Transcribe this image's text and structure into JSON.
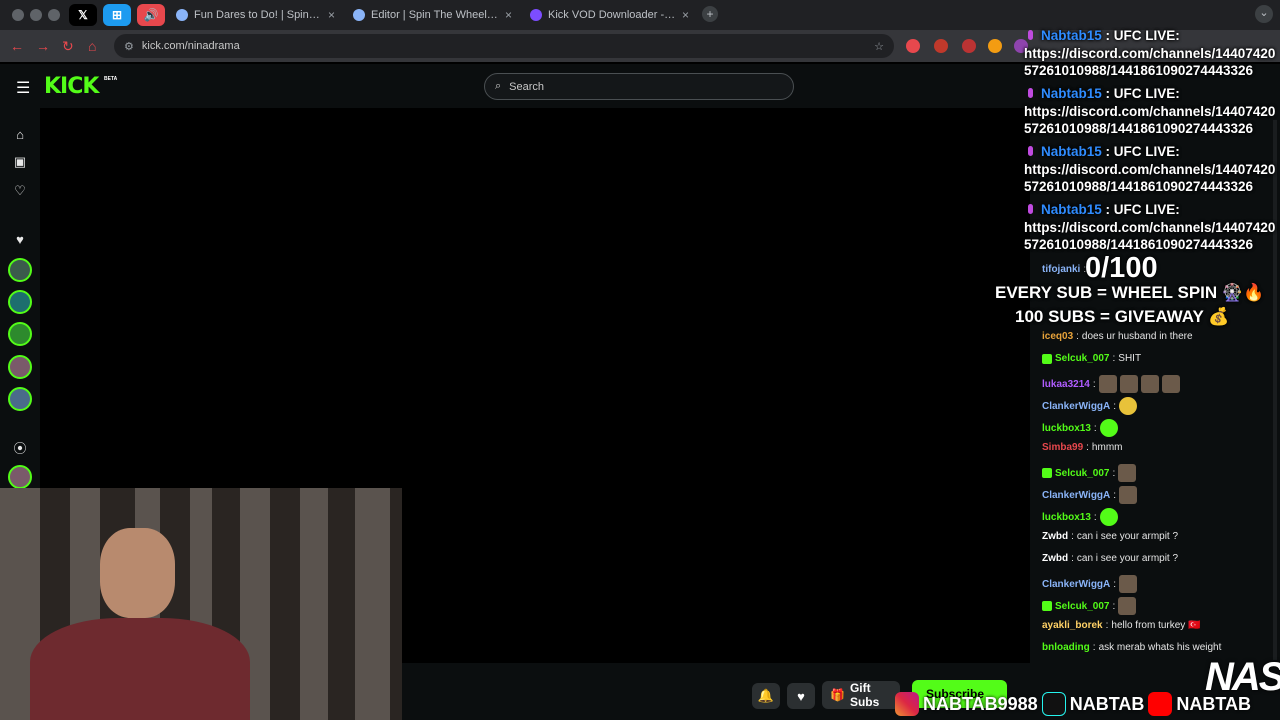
{
  "browser": {
    "pinned_tabs": [
      "𝕏",
      "⊞",
      "🔊"
    ],
    "tabs": [
      {
        "title": "Fun Dares to Do! | Spin The W",
        "close": "×"
      },
      {
        "title": "Editor | Spin The Wheel - Ran",
        "close": "×"
      },
      {
        "title": "Kick VOD Downloader - Strea",
        "close": "×"
      }
    ],
    "new_tab": "+",
    "url": "kick.com/ninadrama",
    "dropdown": "⌄"
  },
  "kick": {
    "logo": "KICK",
    "beta": "BETA",
    "search_placeholder": "Search",
    "gift_subs": "Gift Subs",
    "subscribe": "Subscribe"
  },
  "chat": [
    {
      "user": "tifojanki",
      "color": "#8ab4f8",
      "text": ""
    },
    {
      "user": "iceq03",
      "color": "#e8a33a",
      "text": "does ur husband in there"
    },
    {
      "user": "Selcuk_007",
      "color": "#53fc18",
      "text": "SHIT",
      "badge": true
    },
    {
      "user": "lukaa3214",
      "color": "#b05cff",
      "text": "",
      "emotes": 4
    },
    {
      "user": "ClankerWiggA",
      "color": "#8ab4f8",
      "text": "",
      "emote_y": true
    },
    {
      "user": "luckbox13",
      "color": "#53fc18",
      "text": "",
      "emote_g": true
    },
    {
      "user": "Simba99",
      "color": "#e8484d",
      "text": "hmmm"
    },
    {
      "user": "Selcuk_007",
      "color": "#53fc18",
      "text": "",
      "badge": true,
      "emotes": 1
    },
    {
      "user": "ClankerWiggA",
      "color": "#8ab4f8",
      "text": "",
      "emotes": 1
    },
    {
      "user": "luckbox13",
      "color": "#53fc18",
      "text": "",
      "emote_g": true
    },
    {
      "user": "Zwbd",
      "color": "#fff",
      "text": "can i see your armpit ?"
    },
    {
      "user": "Zwbd",
      "color": "#fff",
      "text": "can i see your armpit ?"
    },
    {
      "user": "ClankerWiggA",
      "color": "#8ab4f8",
      "text": "",
      "emotes": 1
    },
    {
      "user": "Selcuk_007",
      "color": "#53fc18",
      "text": "",
      "badge": true,
      "emotes": 1
    },
    {
      "user": "ayakli_borek",
      "color": "#ffd166",
      "text": "hello from turkey 🇹🇷"
    },
    {
      "user": "bnloading",
      "color": "#53fc18",
      "text": "ask merab whats his weight"
    }
  ],
  "overlay": {
    "alerts": [
      {
        "name": "Nabtab15",
        "l1": " : UFC LIVE:",
        "l2": "https://discord.com/channels/14407420",
        "l3": "57261010988/1441861090274443326"
      },
      {
        "name": "Nabtab15",
        "l1": " : UFC LIVE:",
        "l2": "https://discord.com/channels/14407420",
        "l3": "57261010988/1441861090274443326"
      },
      {
        "name": "Nabtab15",
        "l1": " : UFC LIVE:",
        "l2": "https://discord.com/channels/14407420",
        "l3": "57261010988/1441861090274443326"
      },
      {
        "name": "Nabtab15",
        "l1": " : UFC LIVE:",
        "l2": "https://discord.com/channels/14407420",
        "l3": "57261010988/1441861090274443326"
      }
    ],
    "counter": "0/100",
    "promo1": "EVERY SUB = WHEEL SPIN 🎡🔥",
    "promo2": "100 SUBS = GIVEAWAY 💰",
    "instagram": "NABTAB9988",
    "tiktok": "NABTAB",
    "youtube": "NABTAB",
    "nas": "NAS"
  },
  "colors": {
    "kick_green": "#53fc18",
    "bg": "#0b0e0f",
    "alert_name": "#2f8cff"
  }
}
